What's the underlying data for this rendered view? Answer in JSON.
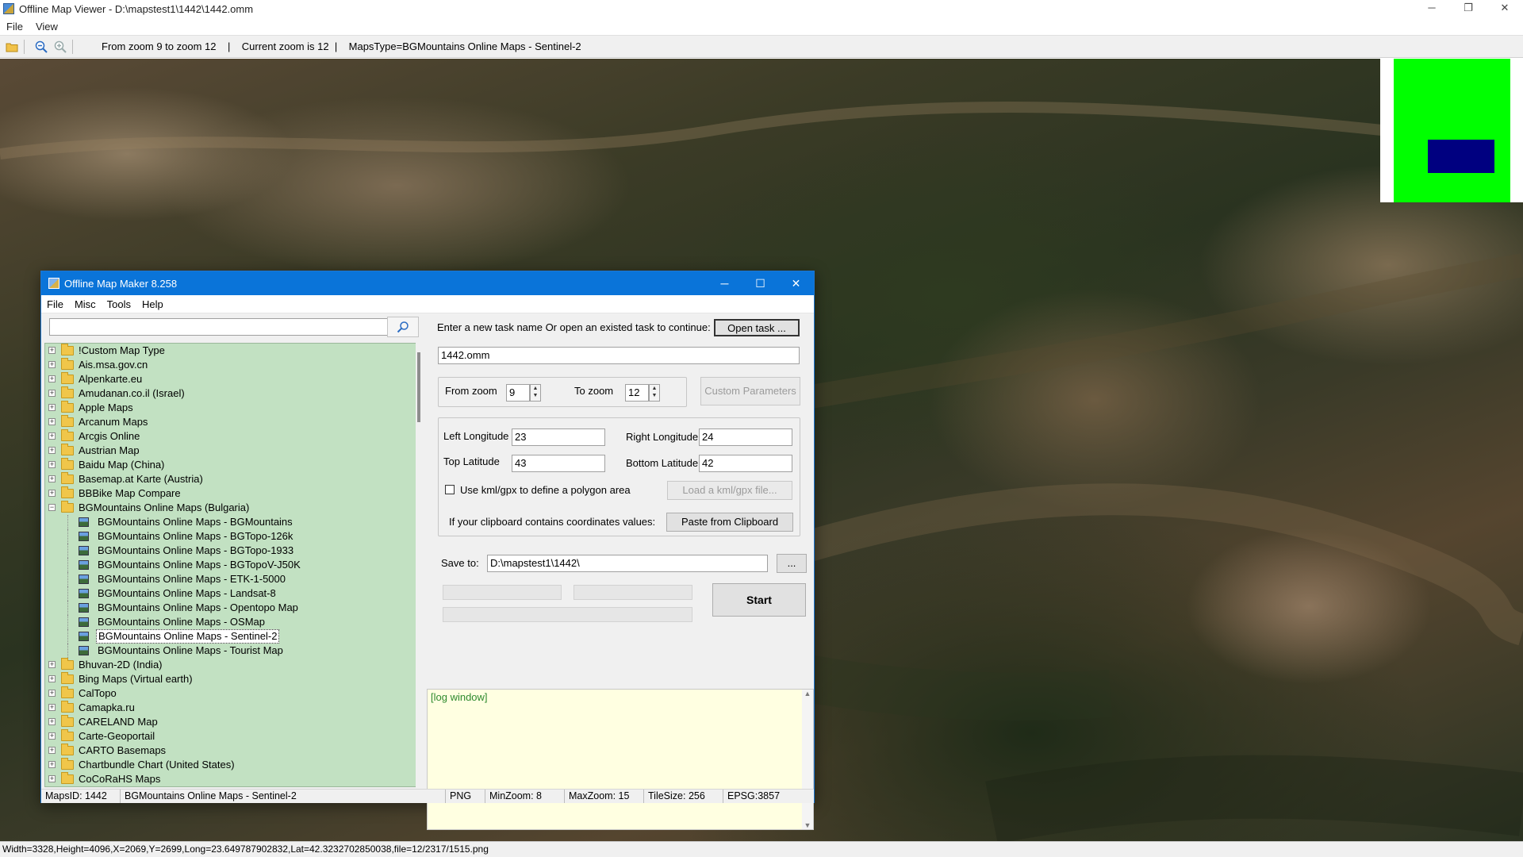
{
  "window": {
    "title": "Offline Map Viewer - D:\\mapstest1\\1442\\1442.omm",
    "controls": [
      "─",
      "❐",
      "✕"
    ]
  },
  "menu": [
    "File",
    "View"
  ],
  "toolbar": {
    "icons": [
      "open-folder-icon",
      "zoom-out-icon",
      "zoom-in-icon"
    ],
    "status": "From zoom 9 to zoom 12    |    Current zoom is 12  |    MapsType=BGMountains Online Maps - Sentinel-2"
  },
  "map_status": "Width=3328,Height=4096,X=2069,Y=2699,Long=23.649787902832,Lat=42.3232702850038,file=12/2317/1515.png",
  "overview_colors": {
    "background": "#00ff00",
    "box": "#000080"
  },
  "dialog": {
    "title": "Offline Map Maker 8.258",
    "controls": [
      "─",
      "☐",
      "✕"
    ],
    "menu": [
      "File",
      "Misc",
      "Tools",
      "Help"
    ],
    "search": {
      "value": "",
      "button_icon": "search-icon"
    },
    "tree": [
      {
        "label": "!Custom Map Type"
      },
      {
        "label": "Ais.msa.gov.cn"
      },
      {
        "label": "Alpenkarte.eu"
      },
      {
        "label": "Amudanan.co.il (Israel)"
      },
      {
        "label": "Apple Maps"
      },
      {
        "label": "Arcanum Maps"
      },
      {
        "label": "Arcgis Online"
      },
      {
        "label": "Austrian Map"
      },
      {
        "label": "Baidu Map (China)"
      },
      {
        "label": "Basemap.at Karte (Austria)"
      },
      {
        "label": "BBBike Map Compare"
      },
      {
        "label": "BGMountains Online Maps (Bulgaria)",
        "expanded": true,
        "children": [
          "BGMountains Online Maps - BGMountains",
          "BGMountains Online Maps - BGTopo-126k",
          "BGMountains Online Maps - BGTopo-1933",
          "BGMountains Online Maps - BGTopoV-J50K",
          "BGMountains Online Maps - ETK-1-5000",
          "BGMountains Online Maps - Landsat-8",
          "BGMountains Online Maps - Opentopo Map",
          "BGMountains Online Maps - OSMap",
          "BGMountains Online Maps - Sentinel-2",
          "BGMountains Online Maps - Tourist Map"
        ],
        "selected_child": 8
      },
      {
        "label": "Bhuvan-2D (India)"
      },
      {
        "label": "Bing Maps (Virtual earth)"
      },
      {
        "label": "CalTopo"
      },
      {
        "label": "Camapka.ru"
      },
      {
        "label": "CARELAND Map"
      },
      {
        "label": "Carte-Geoportail"
      },
      {
        "label": "CARTO Basemaps"
      },
      {
        "label": "Chartbundle Chart (United States)"
      },
      {
        "label": "CoCoRaHS Maps"
      }
    ],
    "form": {
      "task_prompt": "Enter a new task name Or open an existed task to continue:",
      "open_task": "Open task ...",
      "task_name": "1442.omm",
      "from_zoom_label": "From zoom",
      "from_zoom": "9",
      "to_zoom_label": "To zoom",
      "to_zoom": "12",
      "custom_params": "Custom Parameters",
      "left_lon_label": "Left Longitude",
      "left_lon": "23",
      "right_lon_label": "Right Longitude",
      "right_lon": "24",
      "top_lat_label": "Top Latitude",
      "top_lat": "43",
      "bottom_lat_label": "Bottom Latitude",
      "bottom_lat": "42",
      "kml_checkbox": "Use kml/gpx to define a polygon area",
      "load_kml": "Load a kml/gpx file...",
      "clipboard_label": "If your clipboard contains coordinates values:",
      "paste_btn": "Paste from Clipboard",
      "save_to_label": "Save to:",
      "save_to": "D:\\mapstest1\\1442\\",
      "browse_btn": "...",
      "start_btn": "Start"
    },
    "log": "[log window]",
    "status": [
      "MapsID: 1442",
      "BGMountains Online Maps - Sentinel-2",
      "PNG",
      "MinZoom: 8",
      "MaxZoom: 15",
      "TileSize: 256",
      "EPSG:3857"
    ]
  }
}
